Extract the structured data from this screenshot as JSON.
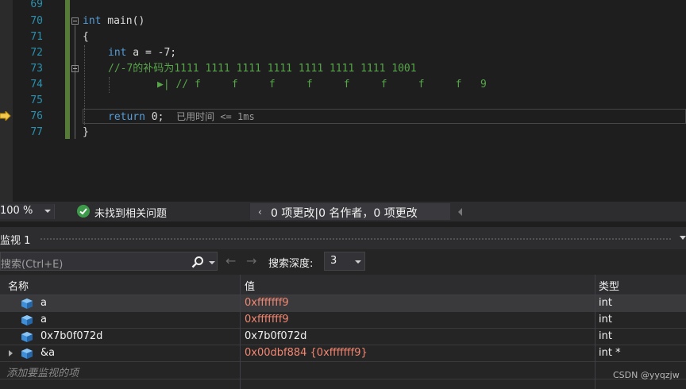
{
  "editor": {
    "line_numbers": [
      "69",
      "70",
      "71",
      "72",
      "73",
      "74",
      "75",
      "76",
      "77"
    ],
    "lines": {
      "l70_kw": "int",
      "l70_rest": " main()",
      "l71": "{",
      "l72_kw": "int",
      "l72_rest": " a = -7;",
      "l73": "//-7的补码为1111 1111 1111 1111 1111 1111 1111 1001",
      "l74_marker": "▶|",
      "l74": "// f     f     f     f     f     f     f     f   9",
      "l76_kw": "return",
      "l76_rest": " 0;",
      "l76_elapsed": "已用时间 <= 1ms",
      "l77": "}"
    }
  },
  "status": {
    "zoom": "100 %",
    "issues": "未找到相关问题",
    "changes": "0 项更改|0 名作者，0 项更改",
    "changes_chevron": "‹"
  },
  "watch": {
    "title": "监视 1",
    "search_placeholder": "搜索(Ctrl+E)",
    "back_arrow": "←",
    "forward_arrow": "→",
    "depth_label": "搜索深度:",
    "depth_value": "3",
    "columns": {
      "name": "名称",
      "value": "值",
      "type": "类型"
    },
    "rows": [
      {
        "name": "a",
        "value": "0xfffffff9",
        "type": "int"
      },
      {
        "name": "a",
        "value": "0xfffffff9",
        "type": "int"
      },
      {
        "name": "0x7b0f072d",
        "value": "0x7b0f072d",
        "type": "int"
      },
      {
        "name": "&a",
        "value": "0x00dbf884 {0xfffffff9}",
        "type": "int *"
      }
    ],
    "add_placeholder": "添加要监视的项"
  },
  "watermark": "CSDN @yyqzjw",
  "colors": {
    "keyword": "#569cd6",
    "comment": "#57a64a",
    "changed_value": "#f48771",
    "line_number": "#2b91af",
    "change_bar": "#567b39"
  }
}
